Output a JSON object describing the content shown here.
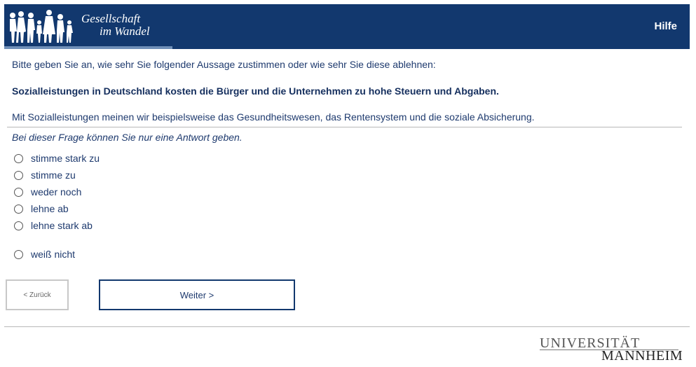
{
  "header": {
    "logo_line1": "Gesellschaft",
    "logo_line2": "im Wandel",
    "help_label": "Hilfe",
    "background_color": "#12386e"
  },
  "question": {
    "intro": "Bitte geben Sie an, wie sehr Sie folgender Aussage zustimmen oder wie sehr Sie diese ablehnen:",
    "statement": "Sozialleistungen in Deutschland kosten die Bürger und die Unternehmen zu hohe Steuern und Abgaben.",
    "explanation": "Mit Sozialleistungen meinen wir beispielsweise das Gesundheitswesen, das Rentensystem und die soziale Absicherung.",
    "instruction": "Bei dieser Frage können Sie nur eine Antwort geben."
  },
  "options": [
    {
      "label": "stimme stark zu",
      "selected": false
    },
    {
      "label": "stimme zu",
      "selected": false
    },
    {
      "label": "weder noch",
      "selected": false
    },
    {
      "label": "lehne ab",
      "selected": false
    },
    {
      "label": "lehne stark ab",
      "selected": false
    },
    {
      "label": "weiß nicht",
      "selected": false
    }
  ],
  "navigation": {
    "back_label": "< Zurück",
    "next_label": "Weiter >"
  },
  "footer": {
    "university_line1": "UNIVERSITÄT",
    "university_line2": "MANNHEIM"
  }
}
